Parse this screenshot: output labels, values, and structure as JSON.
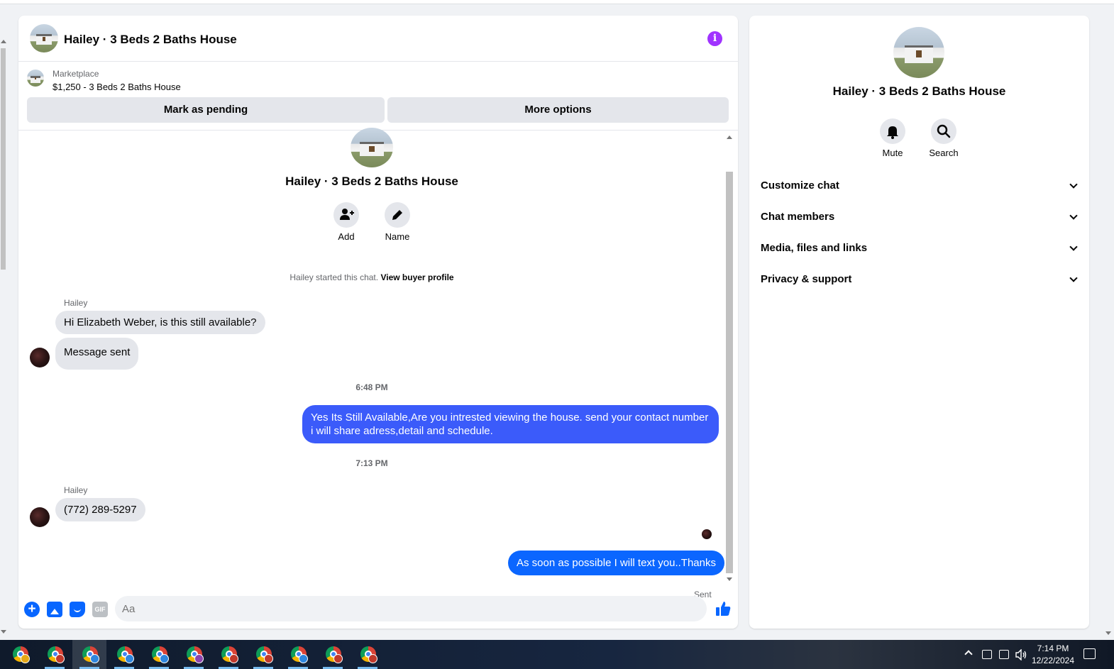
{
  "chat": {
    "title": "Hailey · 3 Beds 2 Baths House",
    "marketplace_label": "Marketplace",
    "listing": "$1,250 - 3 Beds 2 Baths House",
    "mark_pending_label": "Mark as pending",
    "more_options_label": "More options",
    "intro_title": "Hailey · 3 Beds 2 Baths House",
    "add_label": "Add",
    "name_label": "Name",
    "started_text": "Hailey started this chat.",
    "view_profile_label": "View buyer profile",
    "messages": [
      {
        "sender": "Hailey",
        "text": "Hi Elizabeth Weber, is this still available?"
      },
      {
        "text": "Message sent"
      },
      {
        "timestamp": "6:48 PM"
      },
      {
        "text": "Yes Its Still Available,Are you intrested viewing the house. send your contact number i will share adress,detail and schedule."
      },
      {
        "timestamp": "7:13 PM"
      },
      {
        "sender": "Hailey",
        "text": "(772) 289-5297"
      },
      {
        "text": "As soon as possible I will text you..Thanks"
      }
    ],
    "sent_status": "Sent",
    "composer_placeholder": "Aa",
    "gif_label": "GIF",
    "info_glyph": "i"
  },
  "info_panel": {
    "title": "Hailey · 3 Beds 2 Baths House",
    "mute_label": "Mute",
    "search_label": "Search",
    "sections": [
      "Customize chat",
      "Chat members",
      "Media, files and links",
      "Privacy & support"
    ]
  },
  "taskbar": {
    "app_count": 11,
    "active_index": 2,
    "time": "7:14 PM",
    "date": "12/22/2024"
  },
  "colors": {
    "accent": "#0866ff",
    "outgoing_bubble": "#3b5bfa",
    "incoming_bubble": "#e4e6eb",
    "info_icon": "#a033ff"
  },
  "icons": [
    "info-icon",
    "add-person-icon",
    "pencil-icon",
    "bell-icon",
    "search-icon",
    "chevron-down-icon",
    "plus-icon",
    "photo-icon",
    "sticker-icon",
    "gif-icon",
    "emoji-icon",
    "like-icon",
    "chrome-icon"
  ]
}
